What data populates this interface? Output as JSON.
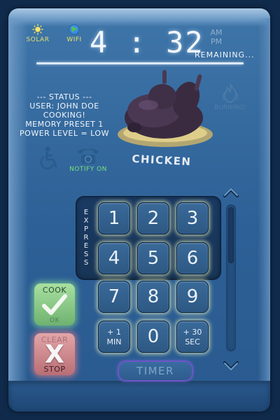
{
  "indicators": {
    "solar": {
      "label": "SOLAR",
      "icon": "sun-icon",
      "color": "#e8e06a"
    },
    "wifi": {
      "label": "WIFI",
      "icon": "globe-icon",
      "color": "#e8e06a"
    }
  },
  "clock": {
    "time": "4 : 32",
    "am": "AM",
    "pm": "PM",
    "remaining": "REMAINING..."
  },
  "status": {
    "header": "--- STATUS ---",
    "user": "USER: JOHN DOE",
    "state": "COOKING!",
    "preset": "MEMORY PRESET 1",
    "power": "POWER LEVEL = LOW"
  },
  "food": {
    "label": "CHICKEN",
    "icon": "roast-chicken-icon"
  },
  "burning": {
    "label": "BURNING!",
    "icon": "flame-icon"
  },
  "notify": {
    "label": "NOTIFY ON",
    "icon": "telephone-icon",
    "color": "#79e07a"
  },
  "accessibility": {
    "icon": "wheelchair-icon"
  },
  "express": {
    "letters": [
      "E",
      "X",
      "P",
      "R",
      "E",
      "S",
      "S"
    ]
  },
  "keypad": {
    "k1": "1",
    "k2": "2",
    "k3": "3",
    "k4": "4",
    "k5": "5",
    "k6": "6",
    "k7": "7",
    "k8": "8",
    "k9": "9",
    "plus1_line1": "+ 1",
    "plus1_line2": "MIN",
    "k0": "0",
    "plus30_line1": "+ 30",
    "plus30_line2": "SEC"
  },
  "cook_button": {
    "top": "COOK",
    "bottom": "OK",
    "icon": "checkmark-icon"
  },
  "clear_button": {
    "top": "CLEAR",
    "glyph": "X",
    "bottom": "STOP"
  },
  "timer_button": {
    "label": "TIMER"
  },
  "colors": {
    "panel": "#2d6096",
    "cook_green": "#6fb270",
    "clear_red": "#b96e75",
    "timer_border": "#6d55c8"
  }
}
